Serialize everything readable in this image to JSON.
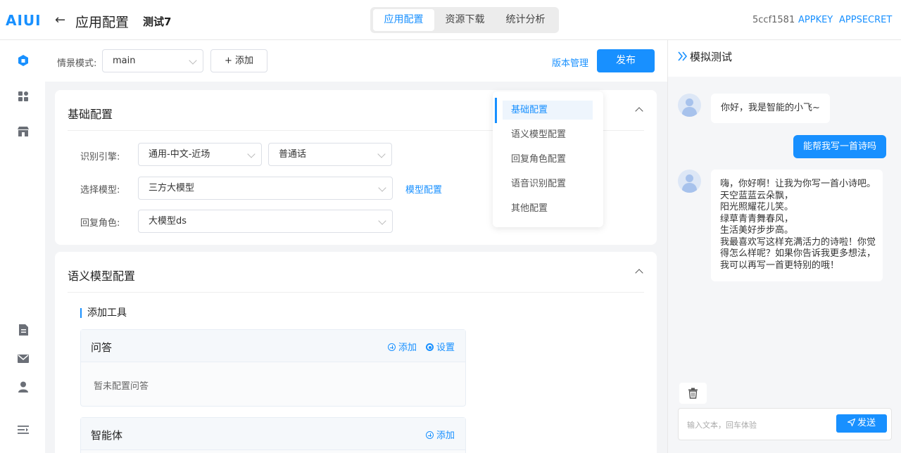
{
  "header": {
    "logo": "AIUI",
    "page_title": "应用配置",
    "app_name": "测试7",
    "tabs": [
      {
        "label": "应用配置",
        "active": true
      },
      {
        "label": "资源下载",
        "active": false
      },
      {
        "label": "统计分析",
        "active": false
      }
    ],
    "app_id": "5ccf1581",
    "appkey_label": "APPKEY",
    "appsecret_label": "APPSECRET"
  },
  "sidebar": {
    "icons": [
      "app-cube-icon",
      "grid-icon",
      "store-icon",
      "document-icon",
      "mail-icon",
      "user-icon",
      "menu-collapse-icon"
    ]
  },
  "toolbar": {
    "scene_label": "情景模式:",
    "scene_value": "main",
    "add_label": "+ 添加",
    "version_label": "版本管理",
    "publish_label": "发布"
  },
  "basic_config": {
    "title": "基础配置",
    "engine_label": "识别引擎:",
    "engine_value": "通用-中文-近场",
    "dialect_value": "普通话",
    "model_label": "选择模型:",
    "model_value": "三方大模型",
    "model_config_link": "模型配置",
    "role_label": "回复角色:",
    "role_value": "大模型ds"
  },
  "anchors": [
    {
      "label": "基础配置",
      "active": true
    },
    {
      "label": "语义模型配置",
      "active": false
    },
    {
      "label": "回复角色配置",
      "active": false
    },
    {
      "label": "语音识别配置",
      "active": false
    },
    {
      "label": "其他配置",
      "active": false
    }
  ],
  "semantic_config": {
    "title": "语义模型配置",
    "add_tool_label": "添加工具",
    "qa": {
      "title": "问答",
      "add_label": "添加",
      "settings_label": "设置",
      "empty_text": "暂未配置问答"
    },
    "agent": {
      "title": "智能体",
      "add_label": "添加"
    }
  },
  "simulator": {
    "title": "模拟测试",
    "messages": [
      {
        "role": "bot",
        "text": "你好，我是智能的小飞~"
      },
      {
        "role": "user",
        "text": "能帮我写一首诗吗"
      },
      {
        "role": "bot",
        "text": "嗨，你好啊！让我为你写一首小诗吧。\n天空蓝蓝云朵飘，\n阳光照耀花儿笑。\n绿草青青舞春风，\n生活美好步步高。\n我最喜欢写这样充满活力的诗啦！你觉\n得怎么样呢？如果你告诉我更多想法，\n我可以再写一首更特别的哦！"
      }
    ],
    "input_placeholder": "输入文本，回车体验",
    "send_label": "发送"
  }
}
